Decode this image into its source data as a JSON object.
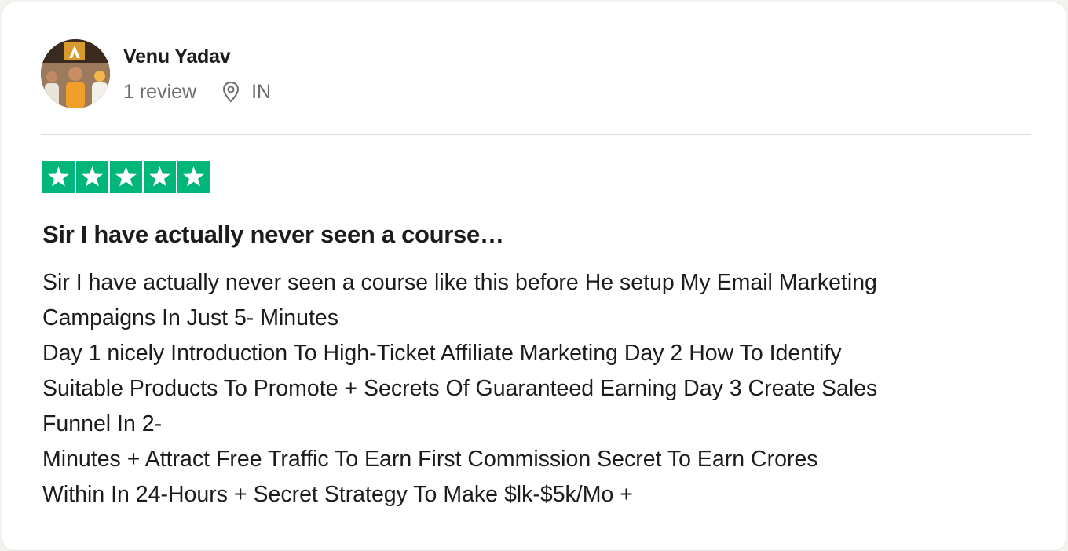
{
  "reviewer": {
    "name": "Venu Yadav",
    "review_count": "1 review",
    "country": "IN"
  },
  "rating": {
    "stars": 5,
    "max_stars": 5,
    "color": "#00b67a"
  },
  "review": {
    "title": "Sir I have actually never seen a course…",
    "lines": [
      "Sir I have actually never seen a course like this before He setup My Email Marketing",
      "Campaigns In Just 5- Minutes",
      "Day 1 nicely Introduction To High-Ticket Affiliate Marketing Day 2 How To Identify",
      "Suitable Products To Promote + Secrets Of Guaranteed Earning Day 3 Create Sales",
      "Funnel In 2-",
      "Minutes + Attract Free Traffic To Earn First Commission Secret To Earn Crores",
      "Within In 24-Hours + Secret Strategy To Make $lk-$5k/Mo +"
    ]
  },
  "icons": {
    "location": "location-pin-icon",
    "star": "star-icon"
  }
}
